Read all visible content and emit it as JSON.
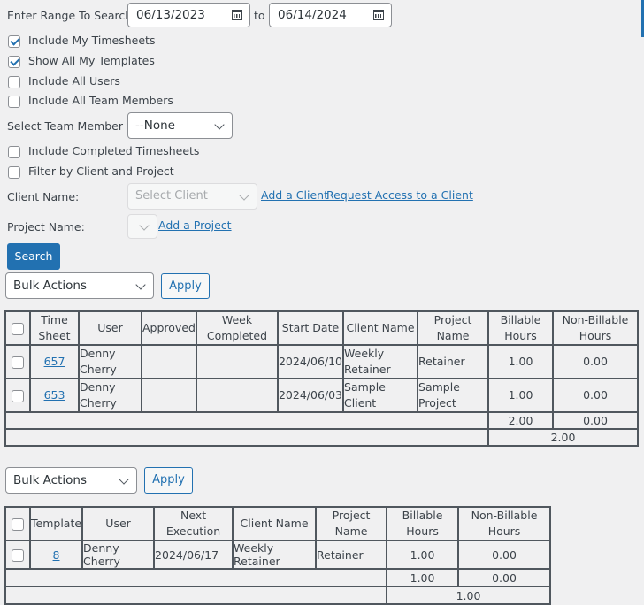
{
  "filters": {
    "range_label": "Enter Range To Search:",
    "start_date": "06/13/2023",
    "to_label": "to",
    "end_date": "06/14/2024",
    "checkboxes": [
      {
        "label": "Include My Timesheets",
        "checked": true
      },
      {
        "label": "Show All My Templates",
        "checked": true
      },
      {
        "label": "Include All Users",
        "checked": false
      },
      {
        "label": "Include All Team Members",
        "checked": false
      }
    ],
    "team_member_label": "Select Team Member",
    "team_member_value": "--None",
    "checkboxes2": [
      {
        "label": "Include Completed Timesheets",
        "checked": false
      },
      {
        "label": "Filter by Client and Project",
        "checked": false
      }
    ],
    "client_label": "Client Name:",
    "client_placeholder": "Select Client",
    "add_client": "Add a Client",
    "request_access": "Request Access to a Client",
    "project_label": "Project Name:",
    "add_project": "Add a Project",
    "search_button": "Search"
  },
  "bulk1": {
    "select_value": "Bulk Actions",
    "apply": "Apply"
  },
  "timesheets": {
    "headers": [
      "Time Sheet",
      "User",
      "Approved",
      "Week Completed",
      "Start Date",
      "Client Name",
      "Project Name",
      "Billable Hours",
      "Non-Billable Hours"
    ],
    "rows": [
      {
        "id": "657",
        "user": "Denny Cherry",
        "approved": "",
        "week_completed": "",
        "start_date": "2024/06/10",
        "client": "Weekly Retainer",
        "project": "Retainer",
        "billable": "1.00",
        "non_billable": "0.00"
      },
      {
        "id": "653",
        "user": "Denny Cherry",
        "approved": "",
        "week_completed": "",
        "start_date": "2024/06/03",
        "client": "Sample Client",
        "project": "Sample Project",
        "billable": "1.00",
        "non_billable": "0.00"
      }
    ],
    "total_billable": "2.00",
    "total_non_billable": "0.00",
    "grand_total": "2.00"
  },
  "bulk2": {
    "select_value": "Bulk Actions",
    "apply": "Apply"
  },
  "templates": {
    "headers": [
      "Template",
      "User",
      "Next Execution",
      "Client Name",
      "Project Name",
      "Billable Hours",
      "Non-Billable Hours"
    ],
    "rows": [
      {
        "id": "8",
        "user": "Denny Cherry",
        "next_execution": "2024/06/17",
        "client": "Weekly Retainer",
        "project": "Retainer",
        "billable": "1.00",
        "non_billable": "0.00"
      }
    ],
    "total_billable": "1.00",
    "total_non_billable": "0.00",
    "grand_total": "1.00"
  }
}
